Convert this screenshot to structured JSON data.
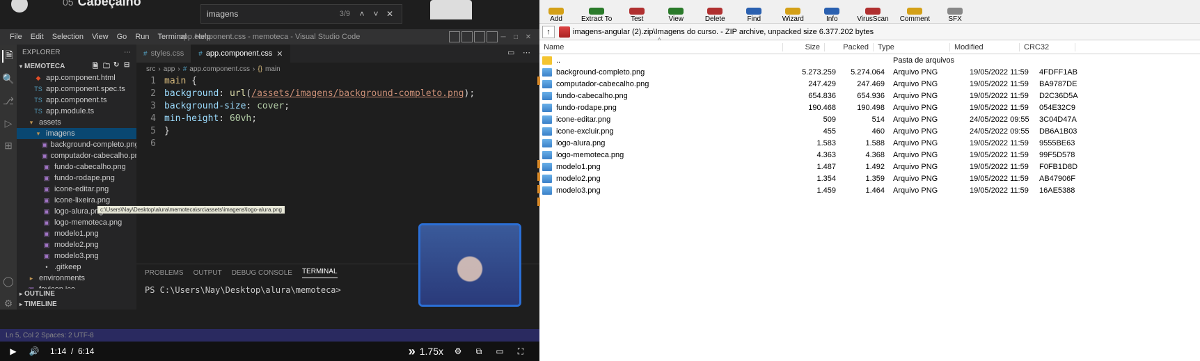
{
  "header": {
    "section_number": "05",
    "section_title": "Cabeçalho"
  },
  "find": {
    "query": "imagens",
    "count": "3/9"
  },
  "vscode": {
    "menus": [
      "File",
      "Edit",
      "Selection",
      "View",
      "Go",
      "Run",
      "Terminal",
      "Help"
    ],
    "window_title": "app.component.css - memoteca - Visual Studio Code",
    "explorer_label": "EXPLORER",
    "project": "MEMOTECA",
    "outline_label": "OUTLINE",
    "timeline_label": "TIMELINE",
    "tree": [
      {
        "name": "app.component.html",
        "icon": "html",
        "indent": 1
      },
      {
        "name": "app.component.spec.ts",
        "icon": "ts",
        "indent": 1
      },
      {
        "name": "app.component.ts",
        "icon": "ts",
        "indent": 1
      },
      {
        "name": "app.module.ts",
        "icon": "ts",
        "indent": 1
      },
      {
        "name": "assets",
        "icon": "folder",
        "indent": 0,
        "expanded": true
      },
      {
        "name": "imagens",
        "icon": "folder",
        "indent": 1,
        "selected": true,
        "expanded": true
      },
      {
        "name": "background-completo.png",
        "icon": "img",
        "indent": 2
      },
      {
        "name": "computador-cabecalho.png",
        "icon": "img",
        "indent": 2
      },
      {
        "name": "fundo-cabecalho.png",
        "icon": "img",
        "indent": 2
      },
      {
        "name": "fundo-rodape.png",
        "icon": "img",
        "indent": 2
      },
      {
        "name": "icone-editar.png",
        "icon": "img",
        "indent": 2
      },
      {
        "name": "icone-lixeira.png",
        "icon": "img",
        "indent": 2
      },
      {
        "name": "logo-alura.png",
        "icon": "img",
        "indent": 2
      },
      {
        "name": "logo-memoteca.png",
        "icon": "img",
        "indent": 2
      },
      {
        "name": "modelo1.png",
        "icon": "img",
        "indent": 2
      },
      {
        "name": "modelo2.png",
        "icon": "img",
        "indent": 2
      },
      {
        "name": "modelo3.png",
        "icon": "img",
        "indent": 2
      },
      {
        "name": ".gitkeep",
        "icon": "file",
        "indent": 2
      },
      {
        "name": "environments",
        "icon": "folder",
        "indent": 0
      },
      {
        "name": "favicon.ico",
        "icon": "img",
        "indent": 0
      }
    ],
    "tooltip_path": "c:\\Users\\Nay\\Desktop\\alura\\memoteca\\src\\assets\\imagens\\logo-alura.png",
    "tabs": [
      {
        "name": "styles.css",
        "active": false
      },
      {
        "name": "app.component.css",
        "active": true
      }
    ],
    "breadcrumb": [
      "src",
      "app",
      "app.component.css",
      "main"
    ],
    "code": {
      "lines": [
        {
          "n": 1,
          "html": "<span class='sel'>main</span> <span class='punct'>{</span>"
        },
        {
          "n": 2,
          "html": "    <span class='prop'>background</span>: <span class='func'>url</span>(<span class='str'>/assets/imagens/background-completo.png</span>);"
        },
        {
          "n": 3,
          "html": "    <span class='prop'>background-size</span>: <span class='num'>cover</span>;"
        },
        {
          "n": 4,
          "html": "    <span class='prop'>min-height</span>: <span class='num'>60vh</span>;"
        },
        {
          "n": 5,
          "html": "<span class='punct'>}</span>"
        },
        {
          "n": 6,
          "html": ""
        }
      ]
    },
    "terminal": {
      "tabs": [
        "PROBLEMS",
        "OUTPUT",
        "DEBUG CONSOLE",
        "TERMINAL"
      ],
      "active_tab": "TERMINAL",
      "prompt": "PS C:\\Users\\Nay\\Desktop\\alura\\memoteca>"
    },
    "statusbar": "Ln 5, Col 2    Spaces: 2    UTF-8"
  },
  "video": {
    "current": "1:14",
    "duration": "6:14",
    "speed": "1.75x"
  },
  "winrar": {
    "toolbar": [
      {
        "label": "Add",
        "color": "#d4a017"
      },
      {
        "label": "Extract To",
        "color": "#2a7a2a"
      },
      {
        "label": "Test",
        "color": "#b03030"
      },
      {
        "label": "View",
        "color": "#2a7a2a"
      },
      {
        "label": "Delete",
        "color": "#b03030"
      },
      {
        "label": "Find",
        "color": "#2a60b0"
      },
      {
        "label": "Wizard",
        "color": "#d4a017"
      },
      {
        "label": "Info",
        "color": "#2a60b0"
      },
      {
        "label": "VirusScan",
        "color": "#b03030"
      },
      {
        "label": "Comment",
        "color": "#d4a017"
      },
      {
        "label": "SFX",
        "color": "#888"
      }
    ],
    "path": "imagens-angular (2).zip\\Imagens do curso. - ZIP archive, unpacked size 6.377.202 bytes",
    "columns": [
      "Name",
      "Size",
      "Packed",
      "Type",
      "Modified",
      "CRC32"
    ],
    "parent_row": {
      "name": "..",
      "type": "Pasta de arquivos"
    },
    "files": [
      {
        "name": "background-completo.png",
        "size": "5.273.259",
        "packed": "5.274.064",
        "type": "Arquivo PNG",
        "modified": "19/05/2022 11:59",
        "crc": "4FDFF1AB"
      },
      {
        "name": "computador-cabecalho.png",
        "size": "247.429",
        "packed": "247.469",
        "type": "Arquivo PNG",
        "modified": "19/05/2022 11:59",
        "crc": "BA9787DE"
      },
      {
        "name": "fundo-cabecalho.png",
        "size": "654.836",
        "packed": "654.936",
        "type": "Arquivo PNG",
        "modified": "19/05/2022 11:59",
        "crc": "D2C36D5A"
      },
      {
        "name": "fundo-rodape.png",
        "size": "190.468",
        "packed": "190.498",
        "type": "Arquivo PNG",
        "modified": "19/05/2022 11:59",
        "crc": "054E32C9"
      },
      {
        "name": "icone-editar.png",
        "size": "509",
        "packed": "514",
        "type": "Arquivo PNG",
        "modified": "24/05/2022 09:55",
        "crc": "3C04D47A"
      },
      {
        "name": "icone-excluir.png",
        "size": "455",
        "packed": "460",
        "type": "Arquivo PNG",
        "modified": "24/05/2022 09:55",
        "crc": "DB6A1B03"
      },
      {
        "name": "logo-alura.png",
        "size": "1.583",
        "packed": "1.588",
        "type": "Arquivo PNG",
        "modified": "19/05/2022 11:59",
        "crc": "9555BE63"
      },
      {
        "name": "logo-memoteca.png",
        "size": "4.363",
        "packed": "4.368",
        "type": "Arquivo PNG",
        "modified": "19/05/2022 11:59",
        "crc": "99F5D578"
      },
      {
        "name": "modelo1.png",
        "size": "1.487",
        "packed": "1.492",
        "type": "Arquivo PNG",
        "modified": "19/05/2022 11:59",
        "crc": "F0FB1D8D"
      },
      {
        "name": "modelo2.png",
        "size": "1.354",
        "packed": "1.359",
        "type": "Arquivo PNG",
        "modified": "19/05/2022 11:59",
        "crc": "AB47906F"
      },
      {
        "name": "modelo3.png",
        "size": "1.459",
        "packed": "1.464",
        "type": "Arquivo PNG",
        "modified": "19/05/2022 11:59",
        "crc": "16AE5388"
      }
    ]
  }
}
